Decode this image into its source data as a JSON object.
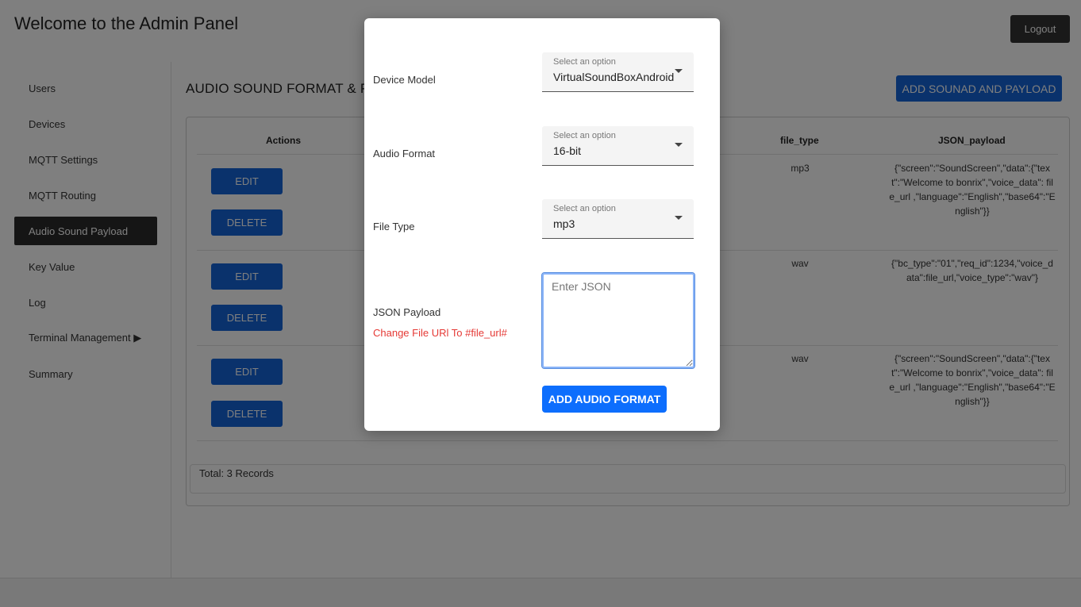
{
  "header": {
    "title": "Welcome to the Admin Panel",
    "logout_label": "Logout"
  },
  "sidebar": {
    "items": [
      {
        "label": "Users"
      },
      {
        "label": "Devices"
      },
      {
        "label": "MQTT Settings"
      },
      {
        "label": "MQTT Routing"
      },
      {
        "label": "Audio Sound Payload",
        "active": true
      },
      {
        "label": "Key Value"
      },
      {
        "label": "Log"
      },
      {
        "label": "Terminal Management ▶"
      },
      {
        "label": "Summary"
      }
    ]
  },
  "main": {
    "section_title": "AUDIO SOUND FORMAT & P",
    "add_button_label": "ADD SOUNAD AND PAYLOAD",
    "table": {
      "columns": {
        "actions": "Actions",
        "file_type": "file_type",
        "json_payload": "JSON_payload"
      },
      "edit_label": "EDIT",
      "delete_label": "DELETE",
      "rows": [
        {
          "file_type": "mp3",
          "json_payload": "{\"screen\":\"SoundScreen\",\"data\":{\"text\":\"Welcome to bonrix\",\"voice_data\": file_url ,\"language\":\"English\",\"base64\":\"English\"}}"
        },
        {
          "file_type": "wav",
          "json_payload": "{\"bc_type\":\"01\",\"req_id\":1234,\"voice_data\":file_url,\"voice_type\":\"wav\"}"
        },
        {
          "file_type": "wav",
          "json_payload": "{\"screen\":\"SoundScreen\",\"data\":{\"text\":\"Welcome to bonrix\",\"voice_data\": file_url ,\"language\":\"English\",\"base64\":\"English\"}}"
        }
      ]
    },
    "total_text": "Total: 3 Records"
  },
  "modal": {
    "device_model": {
      "label": "Device Model",
      "hint": "Select an option",
      "value": "VirtualSoundBoxAndroid"
    },
    "audio_format": {
      "label": "Audio Format",
      "hint": "Select an option",
      "value": "16-bit"
    },
    "file_type": {
      "label": "File Type",
      "hint": "Select an option",
      "value": "mp3"
    },
    "json_payload": {
      "label": "JSON Payload",
      "hint": "Change File URl To #file_url#",
      "placeholder": "Enter JSON"
    },
    "submit_label": "ADD AUDIO FORMAT"
  },
  "colors": {
    "primary": "#1565d8",
    "modal_primary": "#0d6efd",
    "active_nav": "#2b2b2b",
    "hint_red": "#e53935"
  }
}
